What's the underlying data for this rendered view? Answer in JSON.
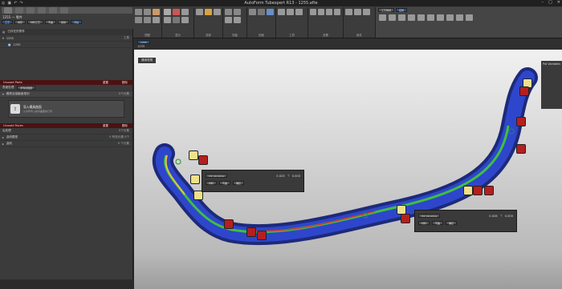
{
  "title": "AutoForm Tubexpert R13 - 1255.afte",
  "ribbon": {
    "tabs": [
      "1255 — 零件",
      "工艺规划",
      "控制"
    ],
    "groups": [
      "视图",
      "显示",
      "选择",
      "测量",
      "剖面",
      "工具",
      "设置",
      "组件"
    ]
  },
  "left_panel": {
    "header": "1255 — 零件",
    "mode_buttons": [
      "工艺",
      "成形",
      "材料工艺",
      "弯曲",
      "模拟",
      "评估"
    ],
    "section_title": "已存在的零件",
    "tree_item": "1255",
    "tree_item_right": "工具",
    "red_bar_1": "Unused Parts",
    "red_bar_1_right": [
      "重置",
      "删除"
    ],
    "filter_label": "表面处理",
    "filter_value": "所有的图层",
    "group_header": "模具及接触面规划",
    "group_header_right": "0个元素",
    "import_title": "导入模具曲面",
    "import_desc": "从文件导入模具曲面的几何",
    "red_bar_2": "Unused Faces",
    "red_bar_2_right": [
      "重置",
      "删除"
    ],
    "list_items": [
      {
        "label": "后处理",
        "right": "0个元素"
      },
      {
        "label": "曲线模型",
        "right": "0 有效元素 0个"
      },
      {
        "label": "曲线",
        "right": "0 个元素"
      }
    ]
  },
  "viewport": {
    "doc_tab": "1255",
    "view_tab": "1255",
    "toolbar_label": "通用视角",
    "side_label": "Pot Variables",
    "infobox1": {
      "mode": "Pot Variables",
      "value": "0.023",
      "min": "0.000",
      "buttons": [
        "材料",
        "弯曲",
        "确定"
      ]
    },
    "infobox2": {
      "mode": "Pot Variables",
      "value": "0.026",
      "min": "0.000",
      "buttons": [
        "材料",
        "弯曲",
        "确定"
      ]
    }
  },
  "colors": {
    "accent_red": "#b51f1f",
    "tube_blue": "#2b3fc2",
    "band_green": "#3fbf3f"
  }
}
